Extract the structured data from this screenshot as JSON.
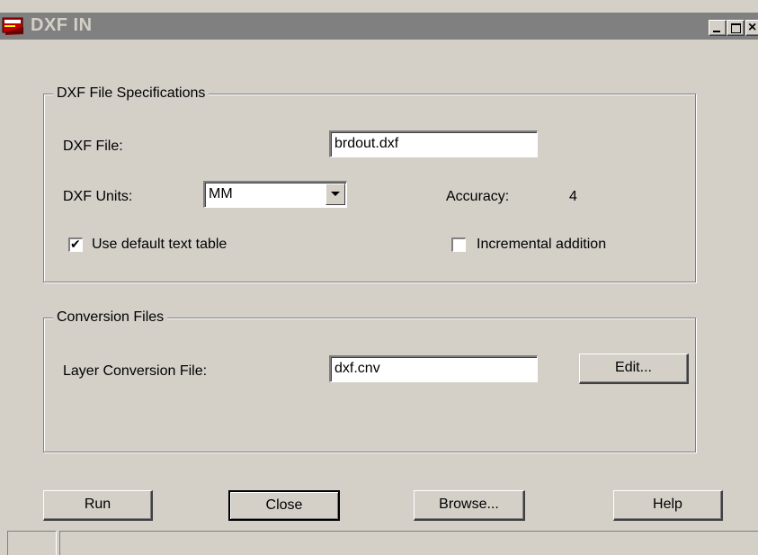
{
  "window": {
    "title": "DXF IN",
    "controls": {
      "minimize": "_",
      "maximize": "□",
      "close": "×"
    }
  },
  "file_spec": {
    "group_label": "DXF File Specifications",
    "dxf_file_label": "DXF File:",
    "dxf_file_value": "brdout.dxf",
    "units_label": "DXF Units:",
    "units_value": "MM",
    "accuracy_label": "Accuracy:",
    "accuracy_value": "4",
    "default_text_table_label": "Use default text table",
    "default_text_table_checked": true,
    "incremental_label": "Incremental addition",
    "incremental_checked": false
  },
  "conversion": {
    "group_label": "Conversion Files",
    "layer_file_label": "Layer Conversion File:",
    "layer_file_value": "dxf.cnv",
    "edit_button": "Edit..."
  },
  "buttons": {
    "run": "Run",
    "close": "Close",
    "browse": "Browse...",
    "help": "Help"
  },
  "icons": {
    "app": "dxf-app-icon",
    "combo_arrow": "chevron-down-icon",
    "check": "checkmark-icon"
  },
  "colors": {
    "face": "#d4d0c8",
    "title_inactive": "#808080",
    "title_text": "#d4d0c8"
  }
}
